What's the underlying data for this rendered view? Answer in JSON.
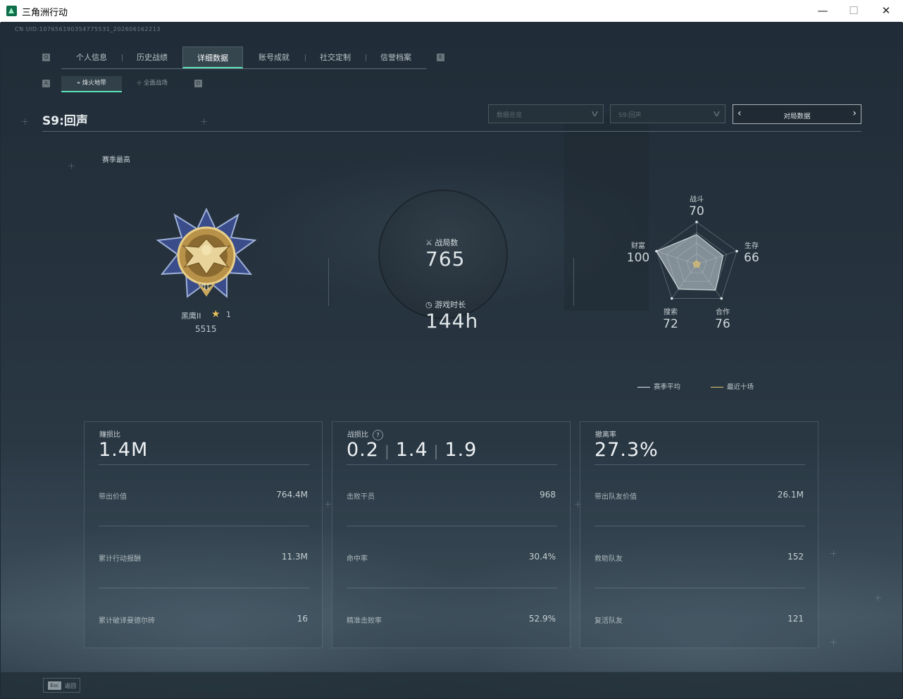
{
  "window": {
    "title": "三角洲行动",
    "minimize": "—",
    "maximize": "☐",
    "close": "✕"
  },
  "header": {
    "uid": "CN UID:107656190354775531_202606162213",
    "key_left": "Q",
    "key_right": "E",
    "tabs": [
      {
        "label": "个人信息"
      },
      {
        "label": "历史战绩"
      },
      {
        "label": "详细数据",
        "active": true
      },
      {
        "label": "账号成就"
      },
      {
        "label": "社交定制"
      },
      {
        "label": "信誉档案"
      }
    ],
    "subtab_key_left": "A",
    "subtab_key_right": "D",
    "subtabs": [
      {
        "label": "烽火地带",
        "active": true,
        "icon": "map-icon"
      },
      {
        "label": "全面战场",
        "active": false,
        "icon": "crosshair-icon"
      }
    ]
  },
  "season": {
    "title": "S9:回声",
    "filter_data": "数据总览",
    "filter_season": "S9:回声",
    "match_data": "对局数据",
    "season_high": "赛季最高"
  },
  "rank": {
    "name": "黑鹰II",
    "stars": "1",
    "score": "5515",
    "star_icon": "star-icon"
  },
  "summary": {
    "matches_label": "战局数",
    "matches_value": "765",
    "time_label": "游戏时长",
    "time_value": "144h"
  },
  "radar": {
    "axes": [
      {
        "label": "战斗",
        "value": "70"
      },
      {
        "label": "生存",
        "value": "66"
      },
      {
        "label": "合作",
        "value": "76"
      },
      {
        "label": "搜索",
        "value": "72"
      },
      {
        "label": "财富",
        "value": "100"
      }
    ],
    "legend_season": "赛季平均",
    "legend_recent": "最近十场",
    "season_color": "#dfe6e9",
    "recent_color": "#e3c26a"
  },
  "cards": [
    {
      "title": "赚损比",
      "big": "1.4M",
      "rows": [
        {
          "label": "带出价值",
          "value": "764.4M"
        },
        {
          "label": "累计行动报酬",
          "value": "11.3M"
        },
        {
          "label": "累计破译曼德尔砖",
          "value": "16"
        }
      ]
    },
    {
      "title": "战损比",
      "help": "?",
      "big_parts": [
        "0.2",
        "1.4",
        "1.9"
      ],
      "rows": [
        {
          "label": "击败干员",
          "value": "968"
        },
        {
          "label": "命中率",
          "value": "30.4%"
        },
        {
          "label": "精准击败率",
          "value": "52.9%"
        }
      ]
    },
    {
      "title": "撤离率",
      "big": "27.3%",
      "rows": [
        {
          "label": "带出队友价值",
          "value": "26.1M"
        },
        {
          "label": "救助队友",
          "value": "152"
        },
        {
          "label": "复活队友",
          "value": "121"
        }
      ]
    }
  ],
  "footer": {
    "esc_key": "Esc",
    "esc_label": "返回"
  },
  "colors": {
    "accent": "#5fe0b8",
    "background": "#1e2a35",
    "gold": "#e3c26a"
  }
}
